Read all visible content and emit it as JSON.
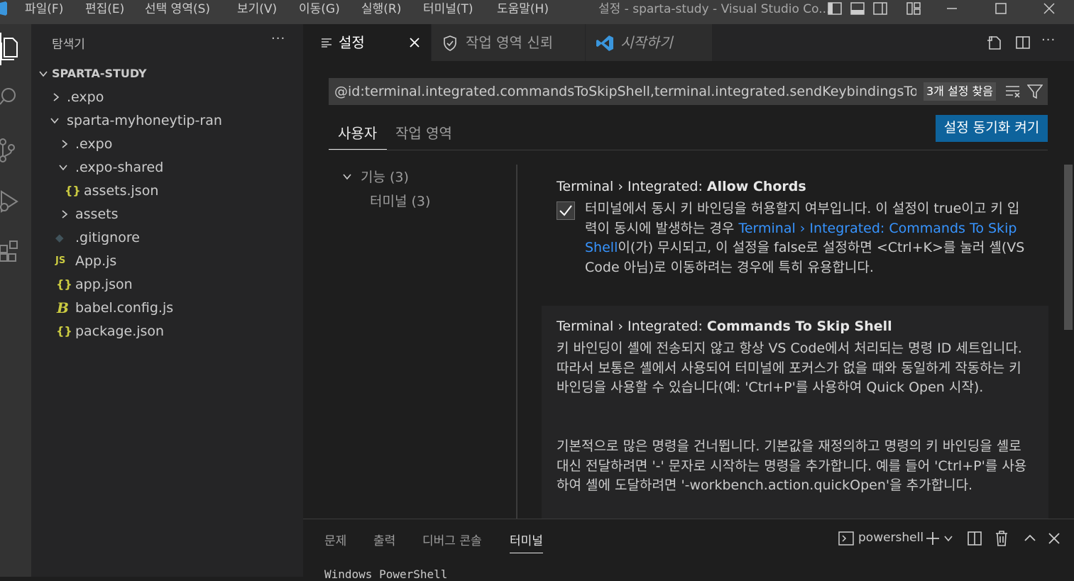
{
  "menu": {
    "file": "파일(F)",
    "edit": "편집(E)",
    "selection": "선택 영역(S)",
    "view": "보기(V)",
    "go": "이동(G)",
    "run": "실행(R)",
    "terminal": "터미널(T)",
    "help": "도움말(H)"
  },
  "window_title": "설정 - sparta-study - Visual Studio Co...",
  "explorer": {
    "title": "탐색기",
    "more": "···",
    "root": "SPARTA-STUDY",
    "items": [
      {
        "label": ".expo"
      },
      {
        "label": "sparta-myhoneytip-ran"
      },
      {
        "label": ".expo"
      },
      {
        "label": ".expo-shared"
      },
      {
        "label": "assets.json"
      },
      {
        "label": "assets"
      },
      {
        "label": ".gitignore"
      },
      {
        "label": "App.js"
      },
      {
        "label": "app.json"
      },
      {
        "label": "babel.config.js"
      },
      {
        "label": "package.json"
      }
    ]
  },
  "tabs": [
    {
      "label": "설정"
    },
    {
      "label": "작업 영역 신뢰"
    },
    {
      "label": "시작하기"
    }
  ],
  "settings": {
    "search_value": "@id:terminal.integrated.commandsToSkipShell,terminal.integrated.sendKeybindingsToShell,ter",
    "result_count": "3개 설정 찾음",
    "scope_tabs": {
      "user": "사용자",
      "workspace": "작업 영역"
    },
    "sync_button": "설정 동기화 켜기",
    "toc": {
      "group": "기능 (3)",
      "item": "터미널 (3)"
    },
    "items": [
      {
        "prefix": "Terminal › Integrated: ",
        "name": "Allow Chords",
        "checked": true,
        "desc_1": "터미널에서 동시 키 바인딩을 허용할지 여부입니다. 이 설정이 true이고 키 입력이 동시에 발생하는 경우 ",
        "desc_link": "Terminal › Integrated: Commands To Skip Shell",
        "desc_2": "이(가) 무시되고, 이 설정을 false로 설정하면 <Ctrl+K>를 눌러 셸(VS Code 아님)로 이동하려는 경우에 특히 유용합니다."
      },
      {
        "prefix": "Terminal › Integrated: ",
        "name": "Commands To Skip Shell",
        "desc_1": "키 바인딩이 셸에 전송되지 않고 항상 VS Code에서 처리되는 명령 ID 세트입니다. 따라서 보통은 셸에서 사용되어 터미널에 포커스가 없을 때와 동일하게 작동하는 키 바인딩을 사용할 수 있습니다(예: 'Ctrl+P'를 사용하여 Quick Open 시작).",
        "desc_2": "기본적으로 많은 명령을 건너뜁니다. 기본값을 재정의하고 명령의 키 바인딩을 셸로 대신 전달하려면 '-' 문자로 시작하는 명령을 추가합니다. 예를 들어 'Ctrl+P'를 사용하여 셸에 도달하려면 '-workbench.action.quickOpen'을 추가합니다."
      }
    ]
  },
  "panel": {
    "tabs": {
      "problems": "문제",
      "output": "출력",
      "debug": "디버그 콘솔",
      "terminal": "터미널"
    },
    "shell": "powershell",
    "terminal_text": "Windows PowerShell"
  },
  "colors": {
    "accent": "#0e639c",
    "link": "#3794ff",
    "vscode_blue": "#3a96dd"
  }
}
